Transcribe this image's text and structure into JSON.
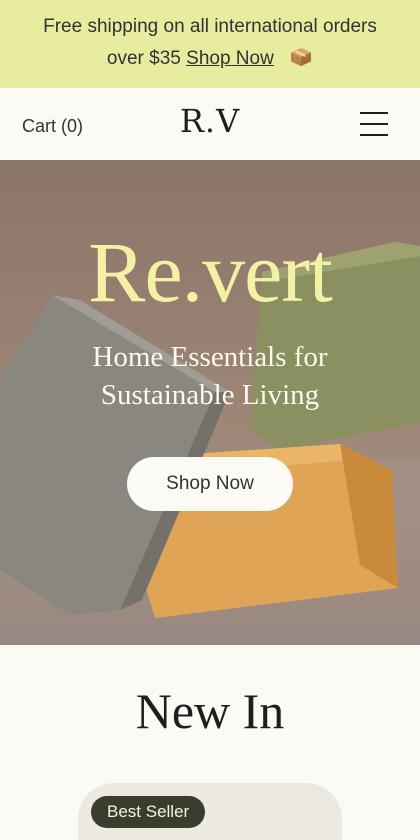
{
  "announcement": {
    "line1": "Free shipping on all international orders",
    "line2_prefix": "over $35",
    "link_label": "Shop Now",
    "icon": "package-icon"
  },
  "header": {
    "cart_label": "Cart (0)",
    "logo": "R.V",
    "menu_icon": "hamburger-menu-icon"
  },
  "hero": {
    "title": "Re.vert",
    "subtitle_line1": "Home Essentials for",
    "subtitle_line2": "Sustainable Living",
    "button_label": "Shop Now"
  },
  "new_in": {
    "title": "New In",
    "product": {
      "badge": "Best Seller"
    }
  },
  "colors": {
    "announcement_bg": "#e8ec9f",
    "hero_title": "#f3f1a6",
    "badge_bg": "#3c3c2c",
    "page_bg": "#fcfaf5"
  }
}
